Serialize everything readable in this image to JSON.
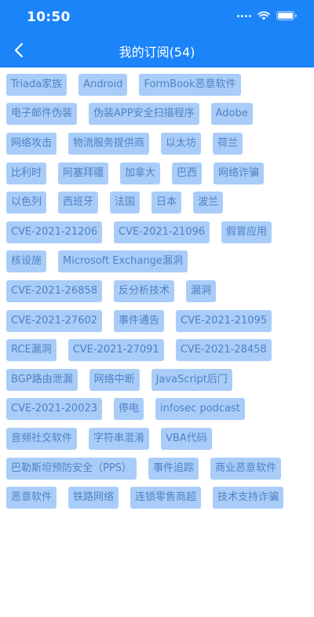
{
  "status_bar": {
    "time": "10:50"
  },
  "header": {
    "title": "我的订阅(54)"
  },
  "tag_rows": [
    [
      "Triada家族",
      "Android",
      "FormBook恶意软件"
    ],
    [
      "电子邮件伪装",
      "伪装APP安全扫描程序",
      "Adobe"
    ],
    [
      "网络攻击",
      "物流服务提供商",
      "以太坊",
      "荷兰"
    ],
    [
      "比利时",
      "阿塞拜疆",
      "加拿大",
      "巴西",
      "网络诈骗"
    ],
    [
      "以色列",
      "西班牙",
      "法国",
      "日本",
      "波兰"
    ],
    [
      "CVE-2021-21206",
      "CVE-2021-21096",
      "假冒应用"
    ],
    [
      "核设施",
      "Microsoft Exchange漏洞"
    ],
    [
      "CVE-2021-26858",
      "反分析技术",
      "漏洞"
    ],
    [
      "CVE-2021-27602",
      "事件通告",
      "CVE-2021-21095"
    ],
    [
      "RCE漏洞",
      "CVE-2021-27091",
      "CVE-2021-28458"
    ],
    [
      "BGP路由泄漏",
      "网络中断",
      "JavaScript后门"
    ],
    [
      "CVE-2021-20023",
      "停电",
      "infosec podcast"
    ],
    [
      "音频社交软件",
      "字符串混淆",
      "VBA代码"
    ],
    [
      "巴勒斯坦预防安全（PPS）",
      "事件追踪",
      "商业恶意软件"
    ],
    [
      "恶意软件",
      "铁路网络",
      "连锁零售商超",
      "技术支持诈骗"
    ]
  ]
}
